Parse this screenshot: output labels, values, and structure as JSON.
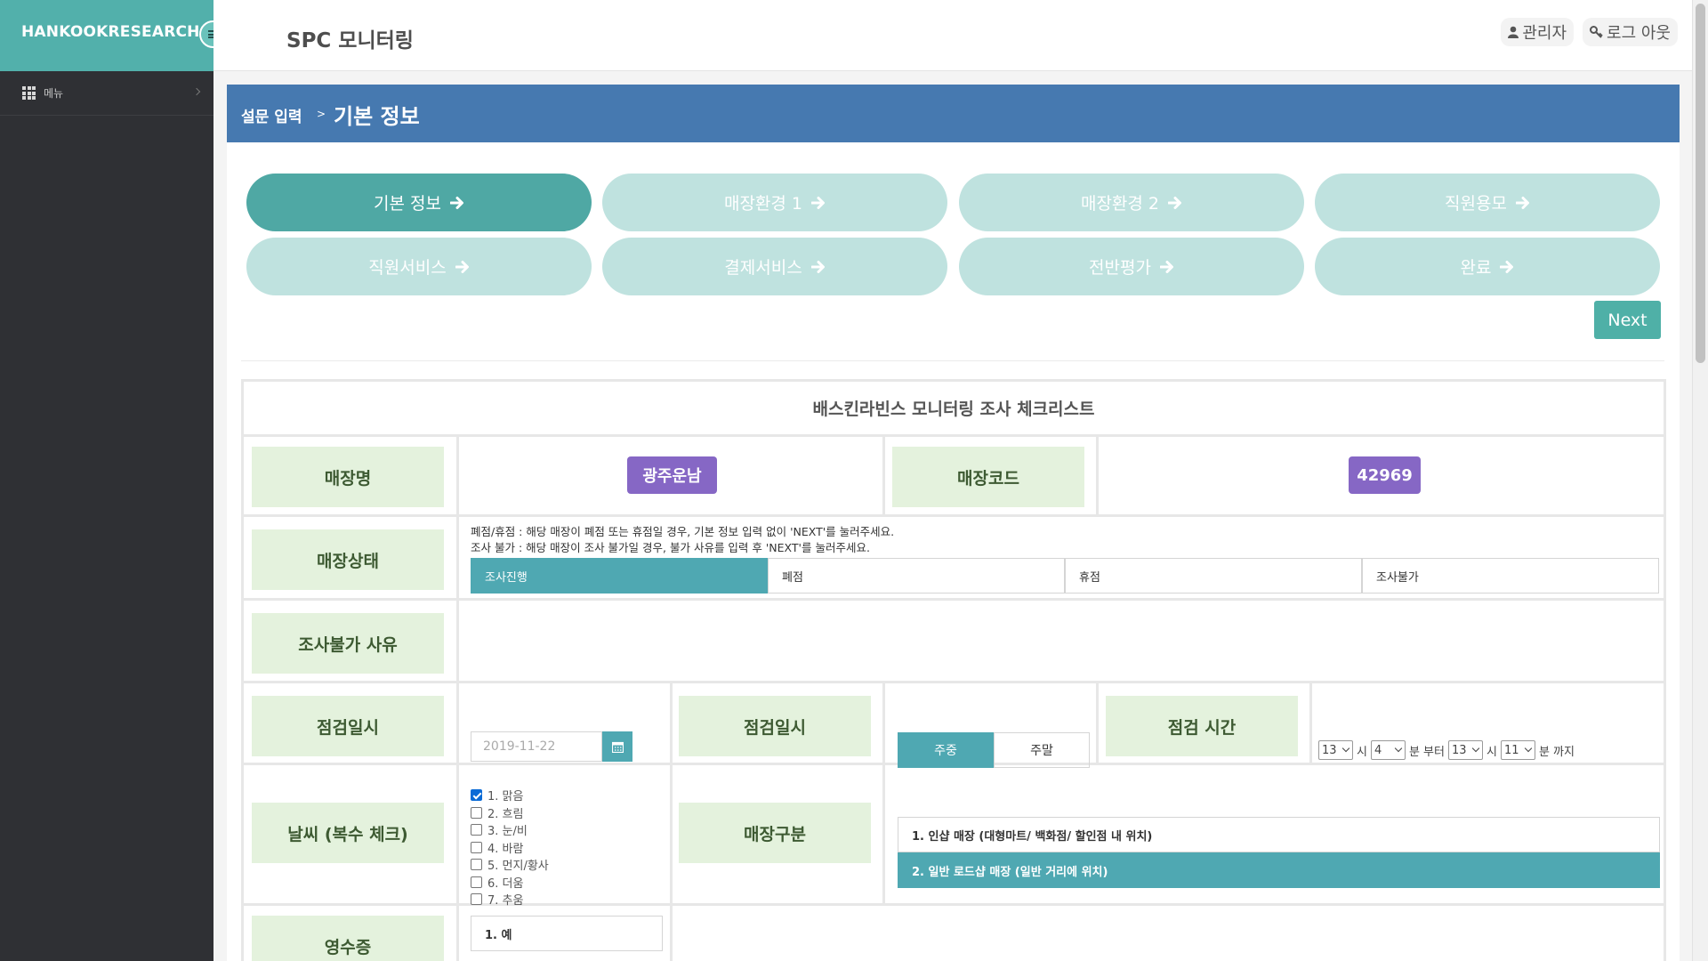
{
  "brand": {
    "name": "HANKOOKRESEARCH"
  },
  "header": {
    "title": "SPC 모니터링",
    "admin_label": "관리자",
    "logout_label": "로그 아웃"
  },
  "sidebar": {
    "items": [
      {
        "label": "메뉴",
        "icon": "grid-icon"
      }
    ]
  },
  "breadcrumb": {
    "parent": "설문 입력",
    "separator": ">",
    "current": "기본 정보"
  },
  "steps": [
    {
      "label": "기본 정보",
      "active": true
    },
    {
      "label": "매장환경 1",
      "active": false
    },
    {
      "label": "매장환경 2",
      "active": false
    },
    {
      "label": "직원용모",
      "active": false
    },
    {
      "label": "직원서비스",
      "active": false
    },
    {
      "label": "결제서비스",
      "active": false
    },
    {
      "label": "전반평가",
      "active": false
    },
    {
      "label": "완료",
      "active": false
    }
  ],
  "next_label": "Next",
  "form": {
    "title": "배스킨라빈스 모니터링 조사 체크리스트",
    "store_name_label": "매장명",
    "store_name": "광주운남",
    "store_code_label": "매장코드",
    "store_code": "42969",
    "status_label": "매장상태",
    "status_note_1": "폐점/휴점 : 해당 매장이 폐점 또는 휴점일 경우, 기본 정보 입력 없이 'NEXT'를 눌러주세요.",
    "status_note_2": "조사 불가 : 해당 매장이 조사 불가일 경우, 불가 사유를 입력 후 'NEXT'를 눌러주세요.",
    "status_options": [
      "조사진행",
      "폐점",
      "휴점",
      "조사불가"
    ],
    "status_selected": "조사진행",
    "reason_label": "조사불가 사유",
    "date_label": "점검일시",
    "date_placeholder": "2019-11-22",
    "day_label": "점검일시",
    "day_options": [
      "주중",
      "주말"
    ],
    "day_selected": "주중",
    "time_label": "점검 시간",
    "time": {
      "start_hour": "13",
      "hour_text_1": "시",
      "start_min": "4",
      "min_text_1": "분 부터",
      "end_hour": "13",
      "hour_text_2": "시",
      "end_min": "11",
      "min_text_2": "분 까지"
    },
    "weather_label": "날씨 (복수 체크)",
    "weather_options": [
      "1. 맑음",
      "2. 흐림",
      "3. 눈/비",
      "4. 바람",
      "5. 먼지/황사",
      "6. 더움",
      "7. 추움"
    ],
    "weather_checked": [
      true,
      false,
      false,
      false,
      false,
      false,
      false
    ],
    "store_type_label": "매장구분",
    "store_type_options": [
      "1. 인샵 매장 (대형마트/ 백화점/ 할인점 내 위치)",
      "2. 일반 로드샵 매장 (일반 거리에 위치)"
    ],
    "store_type_selected_index": 1,
    "receipt_label": "영수증",
    "receipt_options": [
      "1. 예"
    ]
  },
  "colors": {
    "brand_teal": "#52b0ab",
    "header_blue": "#4679b0",
    "active_tab": "#4fa8a4",
    "inactive_tab": "#bfe2df",
    "label_bg": "#e4f2dd",
    "pill_purple": "#8667c5",
    "selected_option": "#4fa8b2",
    "sidebar_bg": "#2f3034"
  }
}
